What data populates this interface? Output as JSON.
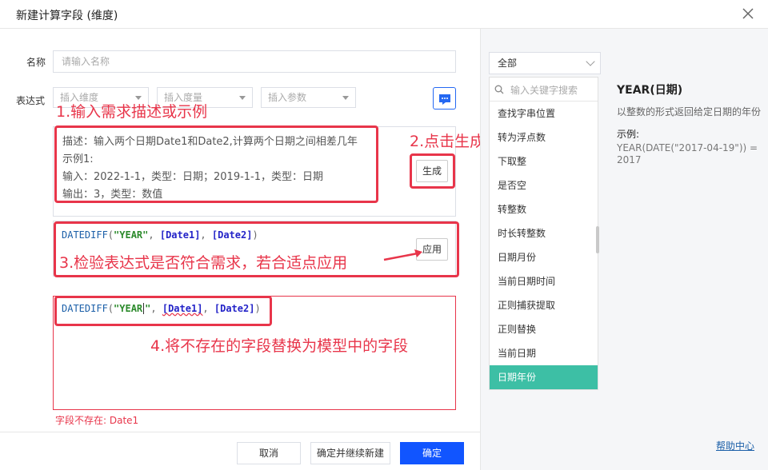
{
  "dialog": {
    "title": "新建计算字段 (维度)"
  },
  "form": {
    "name_label": "名称",
    "name_placeholder": "请输入名称",
    "expr_label": "表达式",
    "insert_dimension": "插入维度",
    "insert_measure": "插入度量",
    "insert_param": "插入参数"
  },
  "annotations": {
    "step1": "1.输入需求描述或示例",
    "step2": "2.点击生成",
    "step3": "3.检验表达式是否符合需求，若合适点应用",
    "step4": "4.将不存在的字段替换为模型中的字段"
  },
  "prompt": {
    "line1": "描述：输入两个日期Date1和Date2,计算两个日期之间相差几年",
    "line2": "示例1:",
    "line3": "输入：2022-1-1，类型：日期；2019-1-1，类型：日期",
    "line4": "输出：3，类型：数值",
    "generate": "生成"
  },
  "generated": {
    "fn": "DATEDIFF",
    "open": "(",
    "str": "\"YEAR\"",
    "sep1": ", ",
    "field1": "[Date1]",
    "sep2": ", ",
    "field2": "[Date2]",
    "close": ")",
    "apply": "应用"
  },
  "editor": {
    "fn": "DATEDIFF",
    "open": "(",
    "str_a": "\"YEAR",
    "str_b": "\"",
    "sep1": ", ",
    "field1": "[Date1]",
    "sep2": ", ",
    "field2": "[Date2]",
    "close": ")",
    "error": "字段不存在: Date1"
  },
  "footer": {
    "cancel": "取消",
    "save_continue": "确定并继续新建",
    "ok": "确定"
  },
  "functions": {
    "category": "全部",
    "search_placeholder": "输入关键字搜索",
    "items": [
      {
        "label": "查找字串位置"
      },
      {
        "label": "转为浮点数"
      },
      {
        "label": "下取整"
      },
      {
        "label": "是否空"
      },
      {
        "label": "转整数"
      },
      {
        "label": "时长转整数"
      },
      {
        "label": "日期月份"
      },
      {
        "label": "当前日期时间"
      },
      {
        "label": "正则捕获提取"
      },
      {
        "label": "正则替换"
      },
      {
        "label": "当前日期"
      },
      {
        "label": "日期年份"
      }
    ]
  },
  "detail": {
    "title": "YEAR(日期)",
    "desc": "以整数的形式返回给定日期的年份",
    "example_label": "示例:",
    "example": "YEAR(DATE(\"2017-04-19\")) = 2017"
  },
  "help": "帮助中心",
  "colors": {
    "accent": "#1155ff",
    "annotation": "#e8354a",
    "active_item": "#3dbfa5"
  }
}
